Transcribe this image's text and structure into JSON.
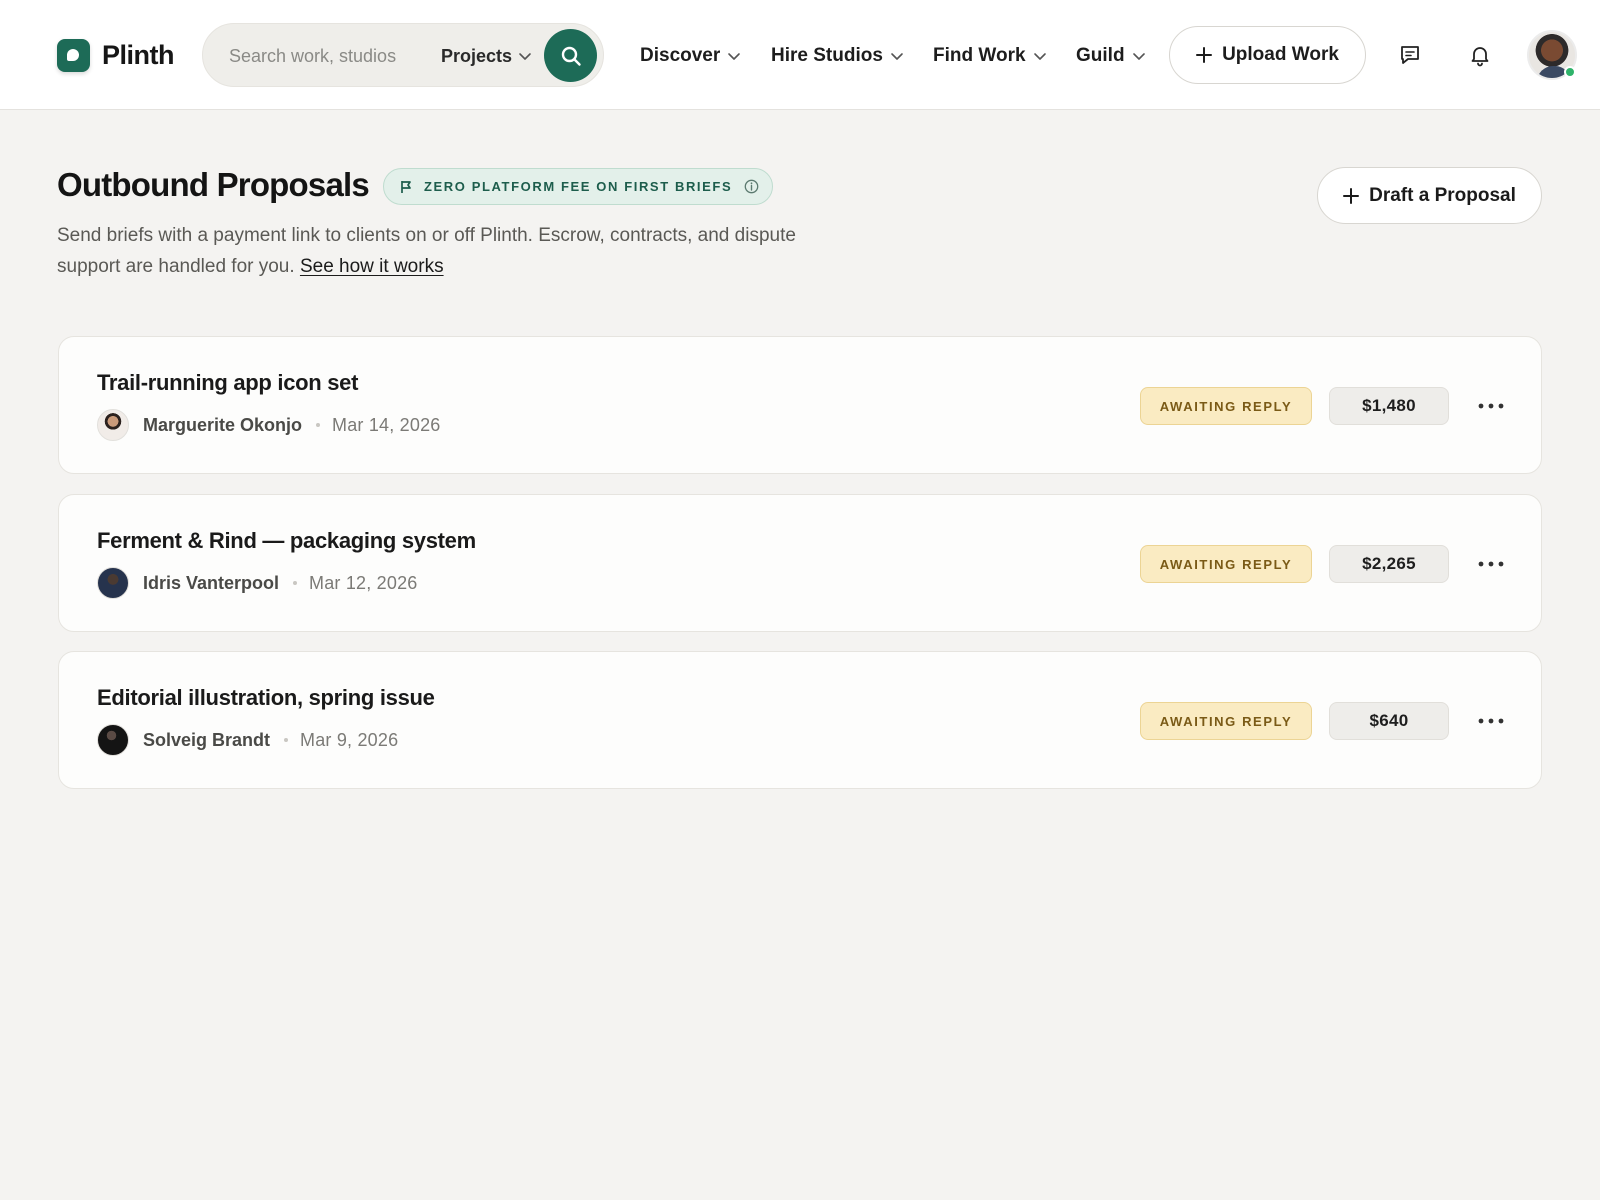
{
  "brand": {
    "name": "Plinth",
    "accent": "#1d6b57"
  },
  "search": {
    "placeholder": "Search work, studios",
    "scope": "Projects"
  },
  "nav": [
    {
      "label": "Discover"
    },
    {
      "label": "Hire Studios"
    },
    {
      "label": "Find Work"
    },
    {
      "label": "Guild"
    }
  ],
  "header": {
    "upload_label": "Upload Work",
    "messages_icon": "chat-icon",
    "notifications_icon": "bell-icon"
  },
  "page": {
    "title": "Outbound Proposals",
    "promo": "ZERO PLATFORM FEE ON FIRST BRIEFS",
    "description": "Send briefs with a payment link to clients on or off Plinth. Escrow, contracts, and dispute support are handled for you.",
    "link": "See how it works",
    "draft_label": "Draft a Proposal"
  },
  "proposals": [
    {
      "title": "Trail-running app icon set",
      "client": "Marguerite Okonjo",
      "date": "Mar 14, 2026",
      "status": "AWAITING REPLY",
      "amount": "$1,480"
    },
    {
      "title": "Ferment & Rind — packaging system",
      "client": "Idris Vanterpool",
      "date": "Mar 12, 2026",
      "status": "AWAITING REPLY",
      "amount": "$2,265"
    },
    {
      "title": "Editorial illustration, spring issue",
      "client": "Solveig Brandt",
      "date": "Mar 9, 2026",
      "status": "AWAITING REPLY",
      "amount": "$640"
    }
  ],
  "colors": {
    "status_bg": "#faebc2",
    "status_text": "#7a5a16",
    "online": "#2fb36a"
  }
}
